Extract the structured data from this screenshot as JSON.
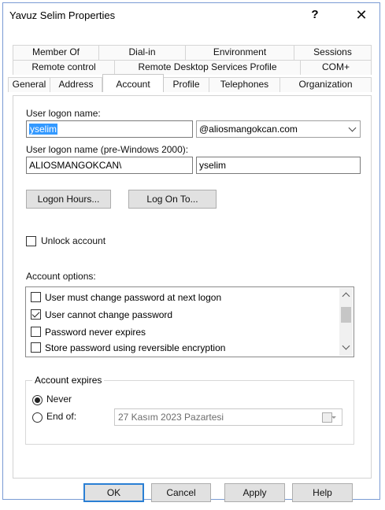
{
  "window": {
    "title": "Yavuz Selim Properties",
    "help_glyph": "?",
    "close_glyph": "✕"
  },
  "tabs": {
    "row1": [
      "Member Of",
      "Dial-in",
      "Environment",
      "Sessions"
    ],
    "row2": [
      "Remote control",
      "Remote Desktop Services Profile",
      "COM+"
    ],
    "row3": [
      "General",
      "Address",
      "Account",
      "Profile",
      "Telephones",
      "Organization"
    ],
    "active": "Account"
  },
  "account": {
    "logon_name_label": "User logon name:",
    "logon_name_value": "yselim",
    "domain_value": "@aliosmangokcan.com",
    "pre2000_label": "User logon name (pre-Windows 2000):",
    "pre2000_domain": "ALIOSMANGOKCAN\\",
    "pre2000_user": "yselim",
    "logon_hours_button": "Logon Hours...",
    "log_on_to_button": "Log On To...",
    "unlock_label": "Unlock account",
    "options_label": "Account options:",
    "options": [
      {
        "label": "User must change password at next logon",
        "checked": false
      },
      {
        "label": "User cannot change password",
        "checked": true
      },
      {
        "label": "Password never expires",
        "checked": false
      },
      {
        "label": "Store password using reversible encryption",
        "checked": false
      }
    ],
    "expires_group": "Account expires",
    "never_label": "Never",
    "end_of_label": "End of:",
    "date_value": "27  Kasım  2023 Pazartesi"
  },
  "footer": {
    "ok": "OK",
    "cancel": "Cancel",
    "apply": "Apply",
    "help": "Help"
  }
}
